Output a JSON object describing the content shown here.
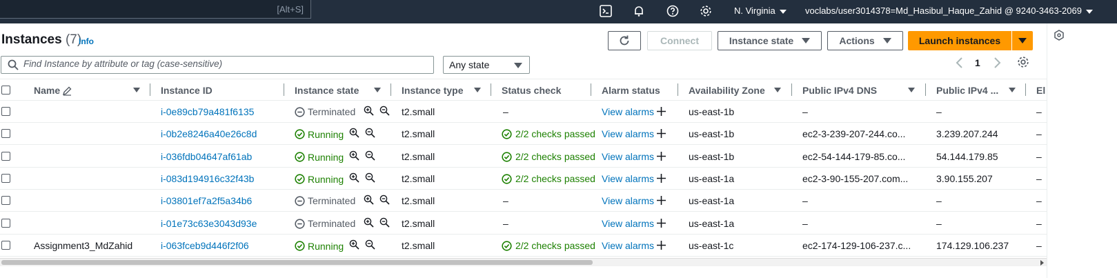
{
  "topnav": {
    "search_shortcut": "[Alt+S]",
    "region": "N. Virginia",
    "account": "voclabs/user3014378=Md_Hasibul_Haque_Zahid @ 9240-3463-2069",
    "icons": [
      "cloudshell-icon",
      "bell-icon",
      "help-icon",
      "gear-icon"
    ]
  },
  "header": {
    "title": "Instances",
    "count": "(7)",
    "info": "Info",
    "refresh_icon": "refresh-icon",
    "connect": "Connect",
    "instance_state": "Instance state",
    "actions": "Actions",
    "launch": "Launch instances"
  },
  "filter": {
    "placeholder": "Find Instance by attribute or tag (case-sensitive)",
    "state": "Any state"
  },
  "pager": {
    "page": "1"
  },
  "colors": {
    "accent": "#ff9900",
    "link": "#0073bb",
    "ok": "#1d8102",
    "nav": "#232f3e"
  },
  "table": {
    "columns": [
      "Name",
      "Instance ID",
      "Instance state",
      "Instance type",
      "Status check",
      "Alarm status",
      "Availability Zone",
      "Public IPv4 DNS",
      "Public IPv4 ...",
      "El"
    ],
    "rows": [
      {
        "name": "",
        "id": "i-0e89cb79a481f6135",
        "state": "Terminated",
        "type": "t2.small",
        "status": "–",
        "alarm": "View alarms",
        "az": "us-east-1b",
        "dns": "–",
        "ip": "–",
        "el": "–"
      },
      {
        "name": "",
        "id": "i-0b2e8246a40e26c8d",
        "state": "Running",
        "type": "t2.small",
        "status": "2/2 checks passed",
        "alarm": "View alarms",
        "az": "us-east-1b",
        "dns": "ec2-3-239-207-244.co...",
        "ip": "3.239.207.244",
        "el": "–"
      },
      {
        "name": "",
        "id": "i-036fdb04647af61ab",
        "state": "Running",
        "type": "t2.small",
        "status": "2/2 checks passed",
        "alarm": "View alarms",
        "az": "us-east-1b",
        "dns": "ec2-54-144-179-85.co...",
        "ip": "54.144.179.85",
        "el": "–"
      },
      {
        "name": "",
        "id": "i-083d194916c32f43b",
        "state": "Running",
        "type": "t2.small",
        "status": "2/2 checks passed",
        "alarm": "View alarms",
        "az": "us-east-1a",
        "dns": "ec2-3-90-155-207.com...",
        "ip": "3.90.155.207",
        "el": "–"
      },
      {
        "name": "",
        "id": "i-03801ef7a2f5a34b6",
        "state": "Terminated",
        "type": "t2.small",
        "status": "–",
        "alarm": "View alarms",
        "az": "us-east-1a",
        "dns": "–",
        "ip": "–",
        "el": "–"
      },
      {
        "name": "",
        "id": "i-01e73c63e3043d93e",
        "state": "Terminated",
        "type": "t2.small",
        "status": "–",
        "alarm": "View alarms",
        "az": "us-east-1a",
        "dns": "–",
        "ip": "–",
        "el": "–"
      },
      {
        "name": "Assignment3_MdZahid",
        "id": "i-063fceb9d446f2f06",
        "state": "Running",
        "type": "t2.small",
        "status": "2/2 checks passed",
        "alarm": "View alarms",
        "az": "us-east-1c",
        "dns": "ec2-174-129-106-237.c...",
        "ip": "174.129.106.237",
        "el": "–"
      }
    ]
  }
}
